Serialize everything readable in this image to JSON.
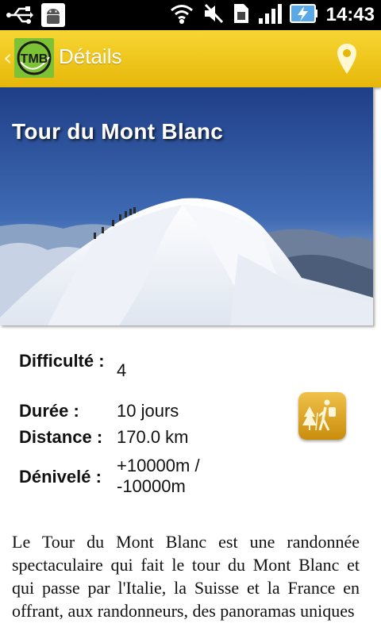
{
  "statusbar": {
    "time": "14:43",
    "icons": [
      "usb-icon",
      "android-debug-icon",
      "wifi-icon",
      "mute-icon",
      "sim-icon",
      "signal-icon",
      "battery-charging-icon"
    ]
  },
  "titlebar": {
    "title": "Détails",
    "logo_text": "TMB",
    "icons": [
      "back-chevron-icon",
      "map-pin-icon"
    ]
  },
  "hero": {
    "title": "Tour du Mont Blanc"
  },
  "details": {
    "difficulty_label": "Difficulté :",
    "difficulty_value": "4",
    "duration_label": "Durée :",
    "duration_value": "10 jours",
    "distance_label": "Distance :",
    "distance_value": "170.0 km",
    "elevation_label": "Dénivelé :",
    "elevation_value": "+10000m / -10000m"
  },
  "hike_button_icon": "hiker-icon",
  "description": "Le Tour du Mont Blanc est une randonnée spectaculaire qui fait le tour du Mont Blanc et qui passe par l'Italie, la Suisse et la France en offrant, aux randonneurs, des panoramas uniques",
  "colors": {
    "titlebar": "#f0c91e",
    "accent": "#d9a21c"
  }
}
